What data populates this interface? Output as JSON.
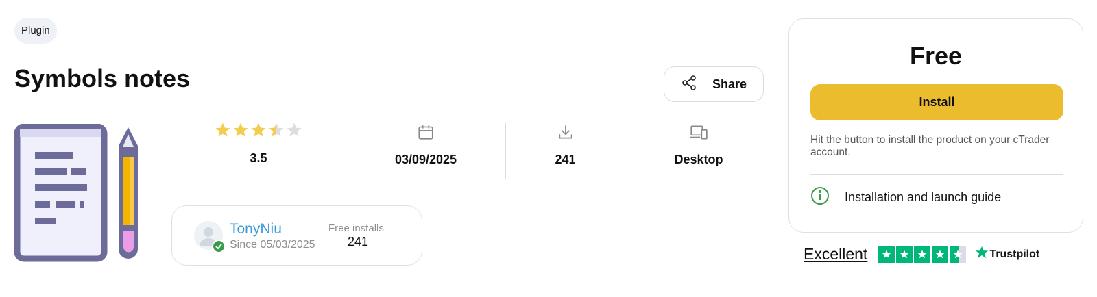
{
  "tag": "Plugin",
  "title": "Symbols notes",
  "share_label": "Share",
  "stats": {
    "rating": {
      "value": "3.5",
      "stars": 3.5,
      "max": 5
    },
    "date": {
      "value": "03/09/2025",
      "icon": "calendar-icon"
    },
    "downloads": {
      "value": "241",
      "icon": "download-icon"
    },
    "platform": {
      "value": "Desktop",
      "icon": "devices-icon"
    }
  },
  "author": {
    "name": "TonyNiu",
    "since": "Since 05/03/2025",
    "free_installs_label": "Free installs",
    "free_installs_value": "241"
  },
  "purchase": {
    "price": "Free",
    "install_label": "Install",
    "hint": "Hit the button to install the product on your cTrader account.",
    "guide_label": "Installation and launch guide"
  },
  "trustpilot": {
    "rating_text": "Excellent",
    "brand": "Trustpilot",
    "stars": 4.5
  },
  "colors": {
    "accent_yellow": "#ebbd2e",
    "star_yellow": "#f2cd4f",
    "author_link": "#3b9bd8",
    "verified_green": "#3b9b4a",
    "trustpilot_green": "#00b67a",
    "icon_purple": "#6d6b99"
  }
}
